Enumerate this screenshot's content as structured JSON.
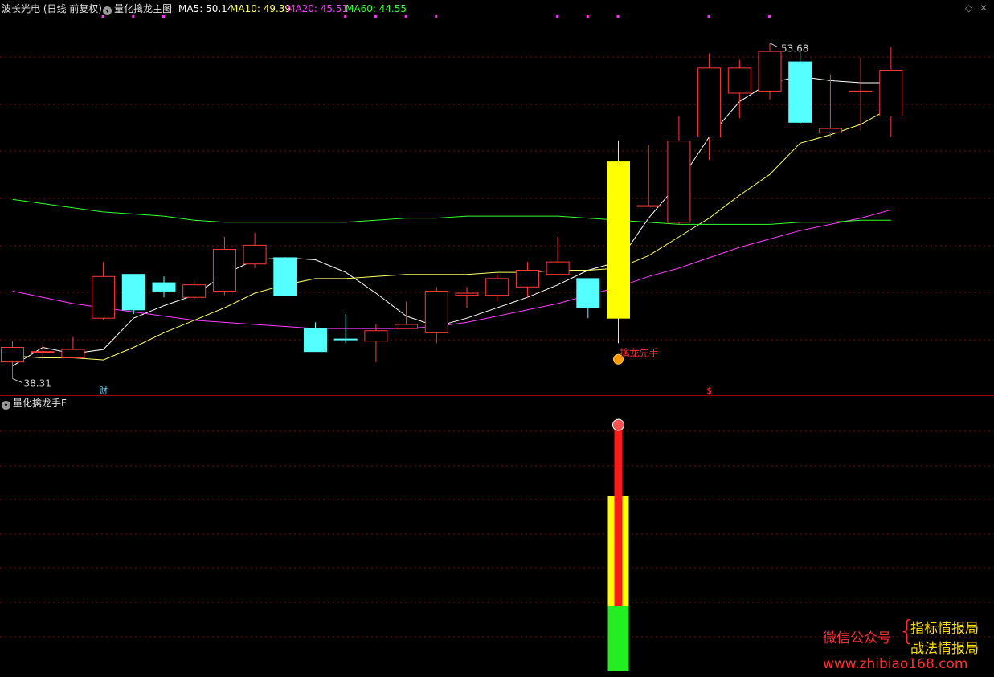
{
  "main_header": {
    "stock": "波长光电 (日线 前复权)",
    "formula": "量化擒龙主图",
    "ma5": "MA5: 50.14",
    "ma10": "MA10: 49.39",
    "ma20": "MA20: 45.51",
    "ma60": "MA60: 44.55"
  },
  "sub_header": {
    "formula": "量化擒龙手F"
  },
  "colors": {
    "up": "#ff3b3b",
    "down": "#54ffff",
    "signal": "#ffff00",
    "ma5": "#ffffff",
    "ma10": "#ffff66",
    "ma20": "#ff3cff",
    "ma60": "#33ff33",
    "grid": "#7a0f0f",
    "divider": "#a00000"
  },
  "chart_data": [
    {
      "type": "candlestick",
      "title": "量化擒龙主图",
      "high_label": "53.68",
      "low_label": "38.31",
      "ylim": [
        37.5,
        55
      ],
      "bars": [
        {
          "o": 38.4,
          "h": 39.4,
          "l": 37.6,
          "c": 39.1,
          "color": "up"
        },
        {
          "o": 38.9,
          "h": 39.2,
          "l": 38.6,
          "c": 38.9,
          "color": "up"
        },
        {
          "o": 38.6,
          "h": 39.6,
          "l": 38.6,
          "c": 39.0,
          "color": "up"
        },
        {
          "o": 40.5,
          "h": 43.2,
          "l": 40.4,
          "c": 42.5,
          "color": "up"
        },
        {
          "o": 42.6,
          "h": 42.6,
          "l": 40.7,
          "c": 40.9,
          "color": "down"
        },
        {
          "o": 42.2,
          "h": 42.5,
          "l": 41.5,
          "c": 41.8,
          "color": "down"
        },
        {
          "o": 41.5,
          "h": 42.3,
          "l": 41.4,
          "c": 42.1,
          "color": "up"
        },
        {
          "o": 41.8,
          "h": 44.4,
          "l": 41.6,
          "c": 43.8,
          "color": "up"
        },
        {
          "o": 43.1,
          "h": 44.6,
          "l": 42.9,
          "c": 44.0,
          "color": "up"
        },
        {
          "o": 43.4,
          "h": 43.4,
          "l": 41.6,
          "c": 41.6,
          "color": "down"
        },
        {
          "o": 40.0,
          "h": 40.3,
          "l": 38.9,
          "c": 38.9,
          "color": "down"
        },
        {
          "o": 39.5,
          "h": 40.7,
          "l": 39.3,
          "c": 39.5,
          "color": "down"
        },
        {
          "o": 39.4,
          "h": 40.2,
          "l": 38.4,
          "c": 39.9,
          "color": "up"
        },
        {
          "o": 40.0,
          "h": 41.3,
          "l": 40.0,
          "c": 40.2,
          "color": "up"
        },
        {
          "o": 39.8,
          "h": 42.0,
          "l": 39.3,
          "c": 41.8,
          "color": "up"
        },
        {
          "o": 41.6,
          "h": 42.0,
          "l": 41.0,
          "c": 41.7,
          "color": "up"
        },
        {
          "o": 41.6,
          "h": 42.6,
          "l": 41.3,
          "c": 42.4,
          "color": "up"
        },
        {
          "o": 42.0,
          "h": 43.2,
          "l": 41.5,
          "c": 42.8,
          "color": "up"
        },
        {
          "o": 42.6,
          "h": 44.4,
          "l": 42.6,
          "c": 43.2,
          "color": "up"
        },
        {
          "o": 42.4,
          "h": 42.4,
          "l": 40.5,
          "c": 41.0,
          "color": "down"
        },
        {
          "o": 40.5,
          "h": 49.0,
          "l": 39.3,
          "c": 48.0,
          "color": "signal"
        },
        {
          "o": 45.9,
          "h": 48.8,
          "l": 45.9,
          "c": 45.9,
          "color": "up"
        },
        {
          "o": 45.1,
          "h": 50.2,
          "l": 45.0,
          "c": 49.0,
          "color": "up"
        },
        {
          "o": 49.2,
          "h": 53.2,
          "l": 48.1,
          "c": 52.5,
          "color": "up"
        },
        {
          "o": 51.3,
          "h": 52.9,
          "l": 50.1,
          "c": 52.5,
          "color": "up"
        },
        {
          "o": 51.4,
          "h": 53.7,
          "l": 51.0,
          "c": 53.3,
          "color": "up"
        },
        {
          "o": 52.8,
          "h": 53.3,
          "l": 49.8,
          "c": 49.9,
          "color": "down"
        },
        {
          "o": 49.4,
          "h": 52.2,
          "l": 49.2,
          "c": 49.6,
          "color": "up"
        },
        {
          "o": 51.4,
          "h": 53.0,
          "l": 49.5,
          "c": 51.4,
          "color": "up"
        },
        {
          "o": 50.2,
          "h": 53.5,
          "l": 49.2,
          "c": 52.4,
          "color": "up"
        }
      ],
      "ma_series": [
        {
          "name": "MA5",
          "color_key": "ma5",
          "values": [
            38.2,
            39.1,
            38.8,
            39.0,
            40.5,
            41.1,
            41.6,
            42.6,
            43.3,
            43.4,
            43.3,
            42.7,
            41.7,
            40.6,
            40.1,
            40.5,
            41.0,
            41.5,
            42.1,
            42.8,
            43.2,
            45.3,
            47.0,
            49.2,
            50.9,
            51.8,
            52.1,
            51.9,
            51.8,
            51.8
          ]
        },
        {
          "name": "MA10",
          "color_key": "ma10",
          "values": [
            38.7,
            38.6,
            38.6,
            38.5,
            39.1,
            39.8,
            40.4,
            41.0,
            41.7,
            42.1,
            42.4,
            42.4,
            42.5,
            42.6,
            42.6,
            42.6,
            42.7,
            42.7,
            42.8,
            42.8,
            42.9,
            43.5,
            44.4,
            45.3,
            46.4,
            47.4,
            48.9,
            49.3,
            49.8,
            50.6
          ]
        },
        {
          "name": "MA20",
          "color_key": "ma20",
          "values": [
            41.8,
            41.5,
            41.2,
            41.0,
            40.8,
            40.6,
            40.4,
            40.3,
            40.2,
            40.1,
            40.0,
            40.0,
            40.0,
            40.0,
            40.1,
            40.3,
            40.6,
            40.9,
            41.2,
            41.6,
            42.0,
            42.5,
            42.9,
            43.4,
            43.9,
            44.3,
            44.7,
            45.0,
            45.3,
            45.7
          ]
        },
        {
          "name": "MA60",
          "color_key": "ma60",
          "values": [
            46.2,
            46.0,
            45.8,
            45.6,
            45.5,
            45.4,
            45.2,
            45.1,
            45.1,
            45.1,
            45.1,
            45.1,
            45.2,
            45.3,
            45.3,
            45.4,
            45.4,
            45.4,
            45.4,
            45.3,
            45.2,
            45.1,
            45.0,
            45.0,
            45.0,
            45.0,
            45.1,
            45.1,
            45.2,
            45.2
          ]
        }
      ],
      "signal": {
        "index": 20,
        "label": "擒龙先手"
      },
      "markers": [
        {
          "index": 3,
          "label": "财"
        },
        {
          "index": 23,
          "label": "$"
        }
      ],
      "top_dots": [
        3,
        4,
        5,
        11,
        12,
        13,
        14,
        18,
        19,
        20,
        23,
        25
      ]
    },
    {
      "type": "bar",
      "title": "量化擒龙手F",
      "ylim": [
        0,
        100
      ],
      "index": 20,
      "segments": [
        {
          "color_key": "green",
          "from": 0,
          "to": 25
        },
        {
          "color_key": "signal",
          "from": 25,
          "to": 67
        },
        {
          "color_key": "red",
          "from": 25,
          "to": 92
        }
      ]
    }
  ],
  "watermark": {
    "wechat": "微信公众号",
    "brace": "{",
    "name1": "指标情报局",
    "name2": "战法情报局",
    "url": "www.zhibiao168.com"
  }
}
